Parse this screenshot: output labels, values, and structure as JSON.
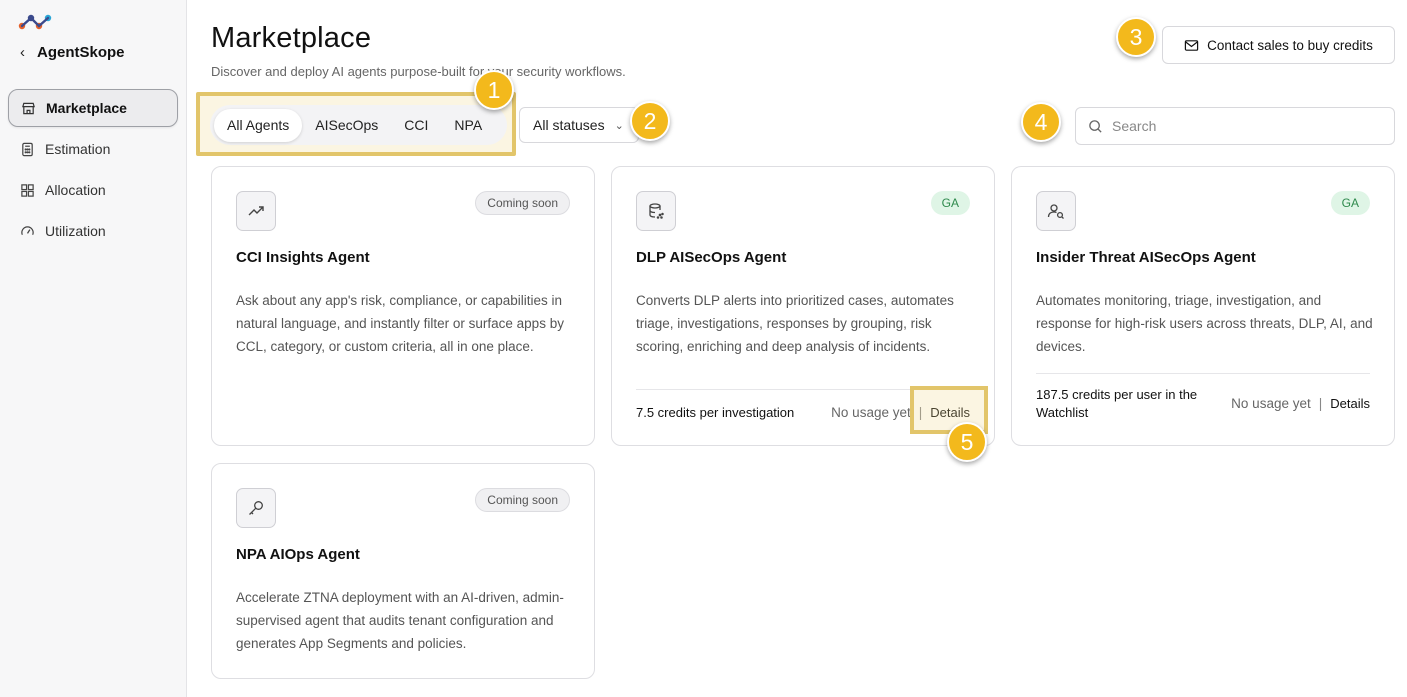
{
  "app": {
    "name": "AgentSkope"
  },
  "sidebar": {
    "items": [
      {
        "label": "Marketplace",
        "icon": "store-icon",
        "active": true
      },
      {
        "label": "Estimation",
        "icon": "calculator-icon"
      },
      {
        "label": "Allocation",
        "icon": "grid-icon"
      },
      {
        "label": "Utilization",
        "icon": "gauge-icon"
      }
    ]
  },
  "header": {
    "title": "Marketplace",
    "subtitle": "Discover and deploy AI agents purpose-built for your security workflows.",
    "contact_label": "Contact sales to buy credits"
  },
  "filters": {
    "tabs": [
      "All Agents",
      "AISecOps",
      "CCI",
      "NPA"
    ],
    "selected_tab": "All Agents",
    "status_selected": "All statuses",
    "search_placeholder": "Search"
  },
  "markers": [
    "1",
    "2",
    "3",
    "4",
    "5"
  ],
  "cards": [
    {
      "title": "CCI Insights Agent",
      "status": "Coming soon",
      "icon": "trend-up-icon",
      "description": "Ask about any app's risk, compliance, or capabilities in natural language, and instantly filter or surface apps by CCL, category, or custom criteria, all in one place."
    },
    {
      "title": "DLP AISecOps Agent",
      "status": "GA",
      "icon": "database-icon",
      "description": "Converts DLP alerts into prioritized cases, automates triage, investigations, responses by grouping, risk scoring, enriching and deep analysis of incidents.",
      "credits": "7.5 credits per investigation",
      "usage": "No usage yet",
      "details": "Details"
    },
    {
      "title": "Insider Threat AISecOps Agent",
      "status": "GA",
      "icon": "user-search-icon",
      "description": "Automates monitoring, triage, investigation, and response for high-risk users across threats, DLP, AI, and devices.",
      "credits": "187.5 credits per user in the Watchlist",
      "usage": "No usage yet",
      "details": "Details"
    },
    {
      "title": "NPA AIOps Agent",
      "status": "Coming soon",
      "icon": "key-icon",
      "description": "Accelerate ZTNA deployment with an AI-driven, admin-supervised agent that audits tenant configuration and generates App Segments and policies."
    }
  ],
  "colors": {
    "marker": "#f3b91c",
    "highlight": "#e2c56a",
    "ga_bg": "#dff5e6",
    "ga_text": "#2f8a4d"
  }
}
